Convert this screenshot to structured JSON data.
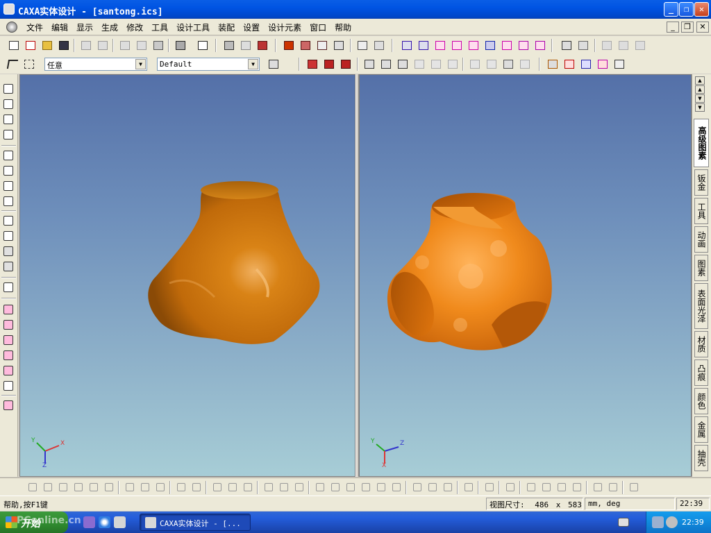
{
  "window": {
    "title": "CAXA实体设计 - [santong.ics]",
    "controls": {
      "minimize": "_",
      "restore": "❐",
      "close": "✕"
    }
  },
  "menubar": {
    "items": [
      "文件",
      "编辑",
      "显示",
      "生成",
      "修改",
      "工具",
      "设计工具",
      "装配",
      "设置",
      "设计元素",
      "窗口",
      "帮助"
    ],
    "doc_controls": {
      "minimize": "_",
      "restore": "❐",
      "close": "✕"
    }
  },
  "toolbar": {
    "selection_filter": "任意",
    "style_combo": "Default"
  },
  "viewports": {
    "left": {
      "axis_x": "X",
      "axis_y": "Y",
      "axis_z": "Z"
    },
    "right": {
      "axis_x": "X",
      "axis_y": "Y",
      "axis_z": "Z"
    },
    "model_color": "#e07a10",
    "background_top": "#5470a8",
    "background_bottom": "#a7cdd6"
  },
  "right_panel": {
    "tabs": [
      "高级图素",
      "钣金",
      "工具",
      "动画",
      "图素",
      "表面光泽",
      "材质",
      "凸痕",
      "颜色",
      "金属",
      "抽壳"
    ],
    "active_tab": "高级图素"
  },
  "statusbar": {
    "help_text": "帮助,按F1键",
    "view_size_label": "视图尺寸:",
    "view_width": "486",
    "view_x": "x",
    "view_height": "583",
    "units": "mm, deg",
    "time": "22:39"
  },
  "taskbar": {
    "start_label": "开始",
    "task_item": "CAXA实体设计 - [...",
    "clock": "22:39"
  },
  "watermark": "PConline.cn"
}
